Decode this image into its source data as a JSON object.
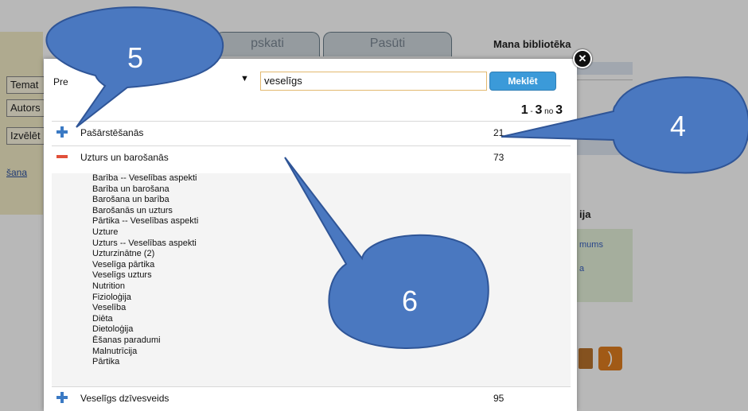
{
  "background": {
    "tabs": [
      "pskati",
      "Pasūti"
    ],
    "right_title": "Mana bibliotēka",
    "side_items": [
      "Temat",
      "Autors",
      "Izvēlēt"
    ],
    "side_link": "šana",
    "right_section": "ija",
    "right_link1": "mums",
    "right_link2": "a"
  },
  "modal": {
    "search_prefix_label": "Pre",
    "query": "veselīgs",
    "search_button": "Meklēt",
    "results_count": {
      "start": "1",
      "sep": " - ",
      "end": "3",
      "of": " no ",
      "total": "3"
    },
    "results": [
      {
        "label": "Pašārstēšanās",
        "count": "21",
        "expanded": false
      },
      {
        "label": "Uzturs un barošanās",
        "count": "73",
        "expanded": true
      },
      {
        "label": "Veselīgs dzīvesveids",
        "count": "95",
        "expanded": false
      }
    ],
    "subterms": [
      "Barība -- Veselības aspekti",
      "Barība un barošana",
      "Barošana un barība",
      "Barošanās un uzturs",
      "Pārtika -- Veselības aspekti",
      "Uzture",
      "Uzturs -- Veselības aspekti",
      "Uzturzinātne (2)",
      "Veselīga pārtika",
      "Veselīgs uzturs",
      "Nutrition",
      "Fizioloģija",
      "Veselība",
      "Diēta",
      "Dietoloģija",
      "Ēšanas paradumi",
      "Malnutrīcija",
      "Pārtika"
    ],
    "close_icon": "close-icon"
  },
  "callouts": [
    "5",
    "4",
    "6"
  ],
  "colors": {
    "callout_fill": "#4a78c0",
    "callout_stroke": "#2f5597",
    "accent": "#3b9ad9",
    "minus": "#e1503a",
    "plus": "#3b7ac4"
  }
}
